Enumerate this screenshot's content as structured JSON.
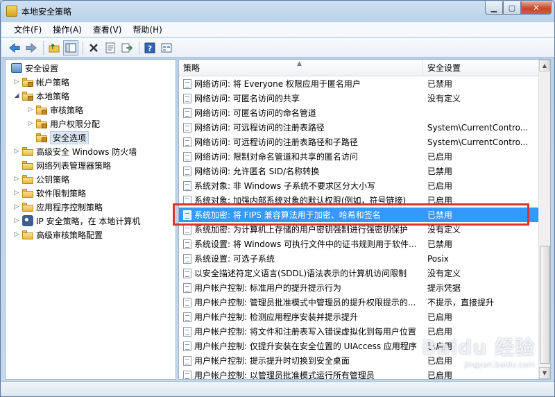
{
  "window": {
    "title": "本地安全策略",
    "minimize_icon": "minimize-icon",
    "maximize_icon": "maximize-icon",
    "close_icon": "close-icon"
  },
  "menu": [
    "文件(F)",
    "操作(A)",
    "查看(V)",
    "帮助(H)"
  ],
  "toolbar": {
    "icons": [
      "back-arrow-icon",
      "forward-arrow-icon",
      "up-folder-icon",
      "show-tree-icon",
      "delete-icon",
      "properties-icon",
      "export-icon",
      "help-icon",
      "view-icon"
    ]
  },
  "tree": {
    "root": "安全设置",
    "items": [
      {
        "label": "帐户策略",
        "level": 1,
        "expander": "▷"
      },
      {
        "label": "本地策略",
        "level": 1,
        "expander": "◢"
      },
      {
        "label": "审核策略",
        "level": 2,
        "expander": "▷"
      },
      {
        "label": "用户权限分配",
        "level": 2,
        "expander": "▷"
      },
      {
        "label": "安全选项",
        "level": 2,
        "expander": "",
        "selected": true
      },
      {
        "label": "高级安全 Windows 防火墙",
        "level": 1,
        "expander": "▷"
      },
      {
        "label": "网络列表管理器策略",
        "level": 1,
        "expander": ""
      },
      {
        "label": "公钥策略",
        "level": 1,
        "expander": "▷"
      },
      {
        "label": "软件限制策略",
        "level": 1,
        "expander": "▷"
      },
      {
        "label": "应用程序控制策略",
        "level": 1,
        "expander": "▷"
      },
      {
        "label": "IP 安全策略，在 本地计算机",
        "level": 1,
        "expander": "▷"
      },
      {
        "label": "高级审核策略配置",
        "level": 1,
        "expander": "▷"
      }
    ]
  },
  "list": {
    "col_policy": "策略",
    "col_setting": "安全设置",
    "sort_indicator": "▲",
    "rows": [
      {
        "policy": "网络访问: 将 Everyone 权限应用于匿名用户",
        "setting": "已禁用"
      },
      {
        "policy": "网络访问: 可匿名访问的共享",
        "setting": "没有定义"
      },
      {
        "policy": "网络访问: 可匿名访问的命名管道",
        "setting": ""
      },
      {
        "policy": "网络访问: 可远程访问的注册表路径",
        "setting": "System\\CurrentContro..."
      },
      {
        "policy": "网络访问: 可远程访问的注册表路径和子路径",
        "setting": "System\\CurrentContro..."
      },
      {
        "policy": "网络访问: 限制对命名管道和共享的匿名访问",
        "setting": "已启用"
      },
      {
        "policy": "网络访问: 允许匿名 SID/名称转换",
        "setting": "已禁用"
      },
      {
        "policy": "系统对象: 非 Windows 子系统不要求区分大小写",
        "setting": "已启用"
      },
      {
        "policy": "系统对象: 加强内部系统对象的默认权限(例如，符号链接)",
        "setting": "已启用"
      },
      {
        "policy": "系统加密: 将 FIPS 兼容算法用于加密、哈希和签名",
        "setting": "已禁用",
        "selected": true
      },
      {
        "policy": "系统加密: 为计算机上存储的用户密钥强制进行强密钥保护",
        "setting": "没有定义"
      },
      {
        "policy": "系统设置: 将 Windows 可执行文件中的证书规则用于软件...",
        "setting": "已禁用"
      },
      {
        "policy": "系统设置: 可选子系统",
        "setting": "Posix"
      },
      {
        "policy": "以安全描述符定义语言(SDDL)语法表示的计算机访问限制",
        "setting": "没有定义"
      },
      {
        "policy": "用户帐户控制: 标准用户的提升提示行为",
        "setting": "提示凭据"
      },
      {
        "policy": "用户帐户控制: 管理员批准模式中管理员的提升权限提示的...",
        "setting": "不提示，直接提升"
      },
      {
        "policy": "用户帐户控制: 检测应用程序安装并提示提升",
        "setting": "已启用"
      },
      {
        "policy": "用户帐户控制: 将文件和注册表写入错误虚拟化到每用户位置",
        "setting": "已启用"
      },
      {
        "policy": "用户帐户控制: 仅提升安装在安全位置的 UIAccess 应用程序",
        "setting": "已启用"
      },
      {
        "policy": "用户帐户控制: 提示提升时切换到安全桌面",
        "setting": "已启用"
      },
      {
        "policy": "用户帐户控制: 以管理员批准模式运行所有管理员",
        "setting": "已启用"
      }
    ]
  },
  "watermark": {
    "text": "Baidu 经验",
    "sub": "jingyan.baidu.com"
  }
}
